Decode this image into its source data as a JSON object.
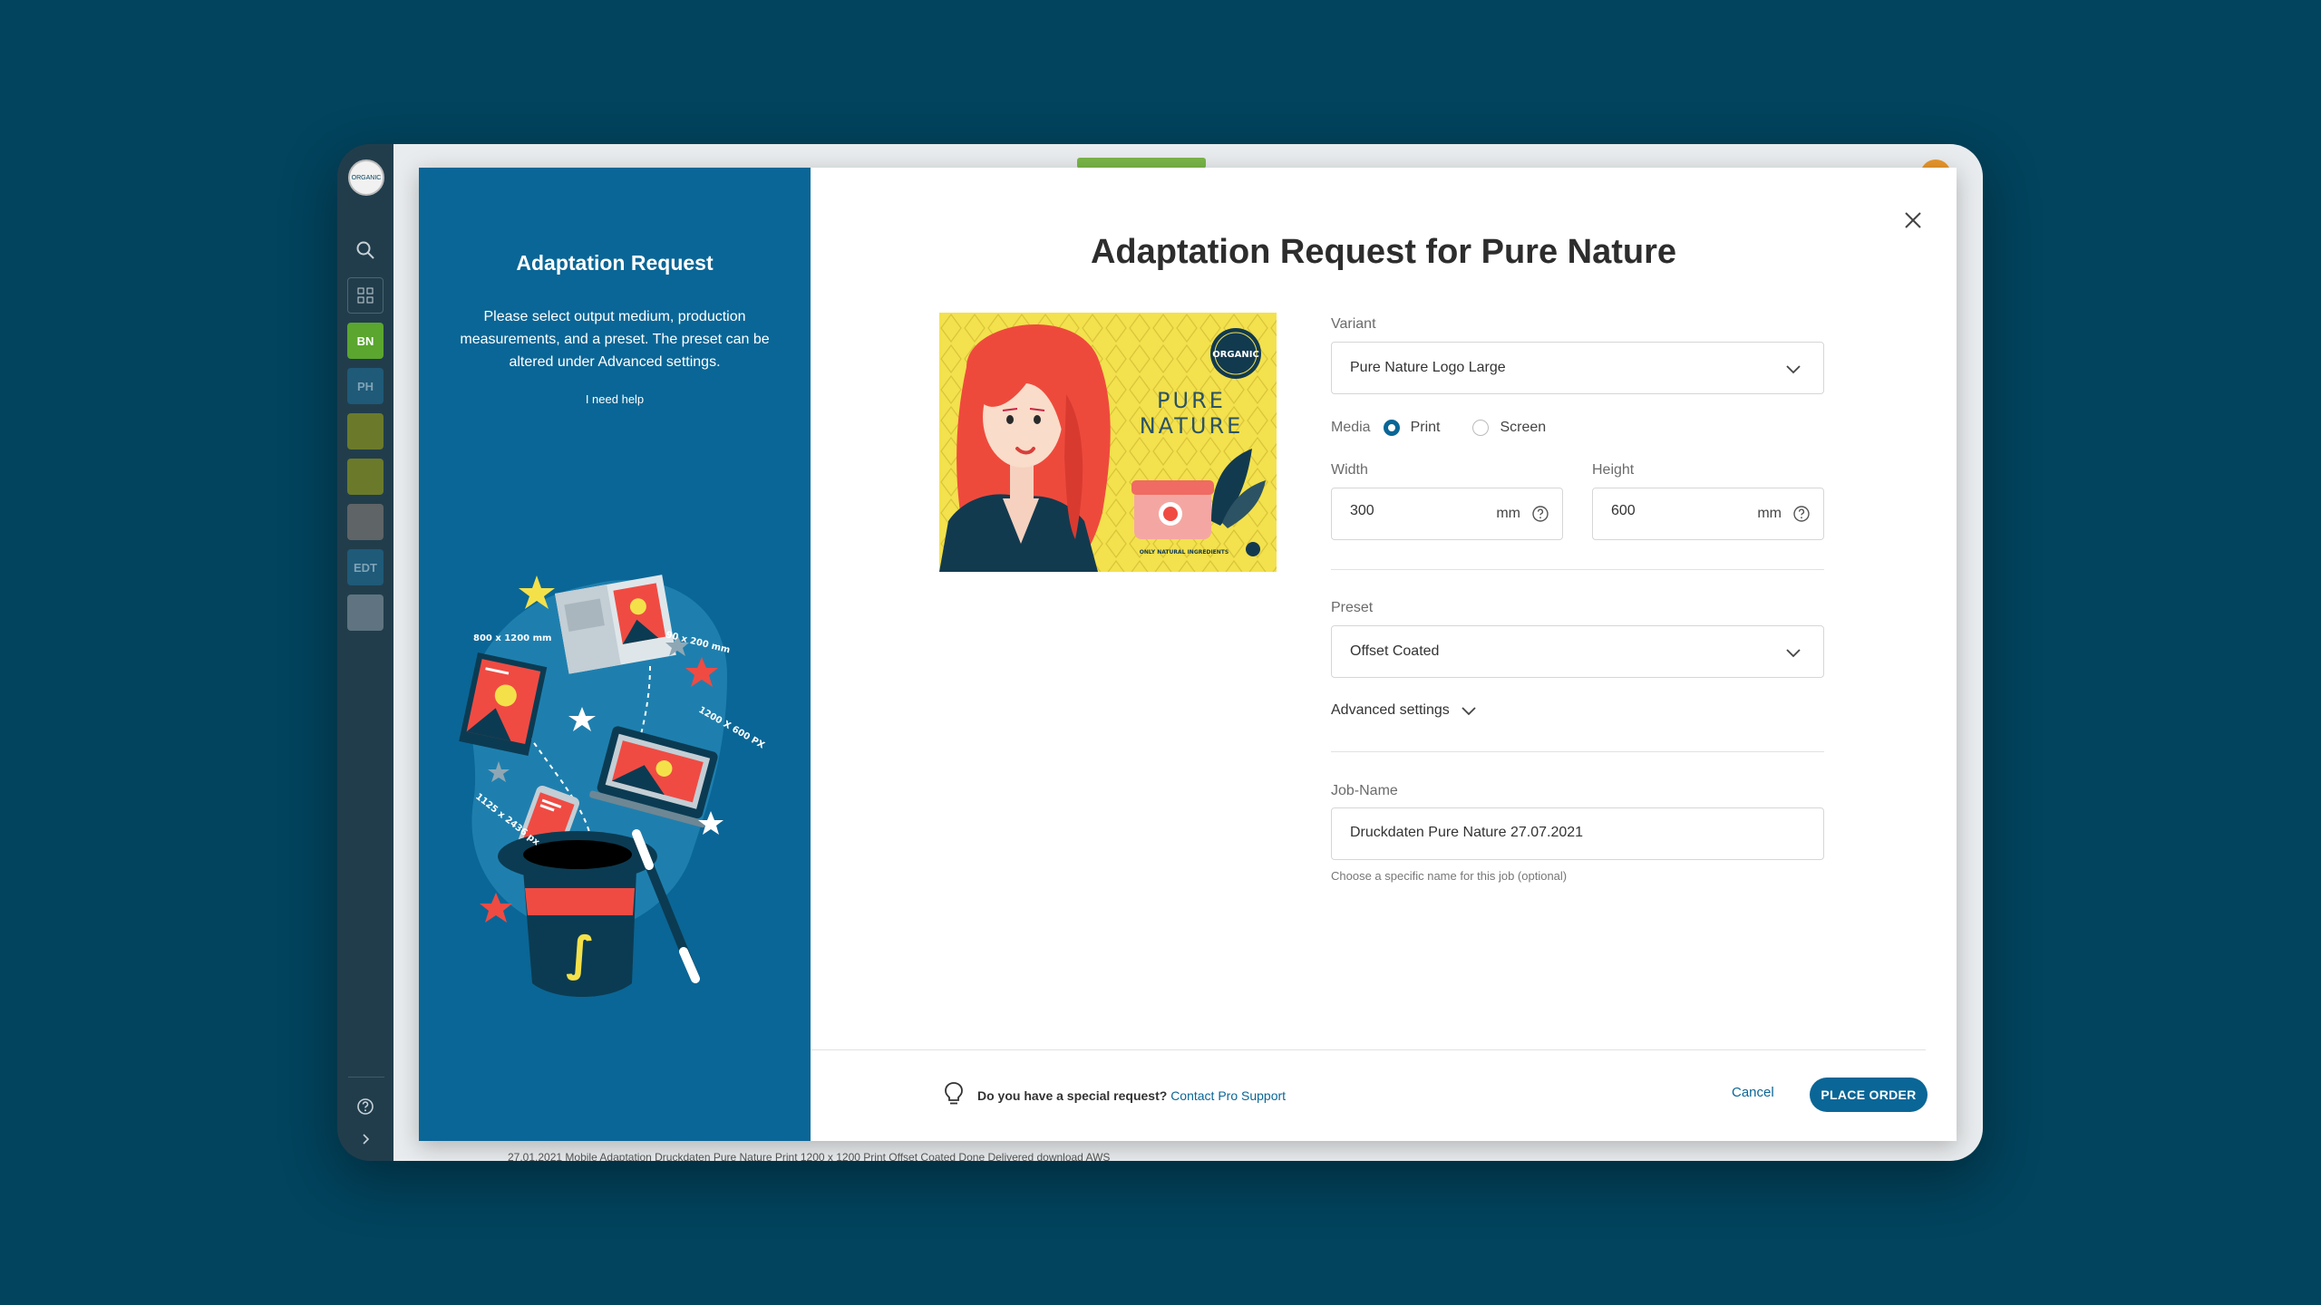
{
  "rail": {
    "logo": "ORGANIC",
    "items": [
      {
        "label": "",
        "icon": "search-icon",
        "color": "#213d4c"
      },
      {
        "label": "",
        "icon": "grid-icon",
        "color": "#213d4c"
      },
      {
        "label": "BN",
        "color": "#5aa62e"
      },
      {
        "label": "PH",
        "color": "#1f5a78"
      },
      {
        "label": "",
        "color": "#6b7a2a"
      },
      {
        "label": "",
        "color": "#6b7a2a"
      },
      {
        "label": "",
        "color": "#5f6466"
      },
      {
        "label": "EDT",
        "color": "#1f5a78"
      },
      {
        "label": "",
        "color": "#5f7480"
      }
    ]
  },
  "app": {
    "footer_text": "27.01.2021    Mobile   Adaptation   Druckdaten Pure Nature   Print   1200 x 1200   Print   Offset Coated   Done   Delivered   download   AWS"
  },
  "left_panel": {
    "title": "Adaptation Request",
    "description": "Please select output medium, production measurements, and a preset. The preset can be altered under Advanced settings.",
    "help_link": "I need help",
    "illustration_labels": [
      "800 x 1200 mm",
      "90 x 200 mm",
      "1200 X 600 PX",
      "1125 x 2436 px"
    ]
  },
  "modal": {
    "title": "Adaptation Request for Pure Nature"
  },
  "preview": {
    "badge": "ORGANIC",
    "brand_line1": "PURE",
    "brand_line2": "NATURE",
    "tagline": "ONLY NATURAL INGREDIENTS"
  },
  "form": {
    "variant": {
      "label": "Variant",
      "value": "Pure Nature Logo Large"
    },
    "media": {
      "label": "Media",
      "options": [
        {
          "label": "Print",
          "selected": true
        },
        {
          "label": "Screen",
          "selected": false
        }
      ]
    },
    "width": {
      "label": "Width",
      "value": "300",
      "unit": "mm"
    },
    "height": {
      "label": "Height",
      "value": "600",
      "unit": "mm"
    },
    "preset": {
      "label": "Preset",
      "value": "Offset Coated"
    },
    "advanced": {
      "label": "Advanced settings"
    },
    "job_name": {
      "label": "Job-Name",
      "value": "Druckdaten Pure Nature 27.07.2021",
      "hint": "Choose a specific name for this job (optional)"
    }
  },
  "footer": {
    "question": "Do you have a special request?",
    "link": "Contact Pro Support",
    "cancel": "Cancel",
    "place_order": "PLACE ORDER"
  },
  "colors": {
    "background": "#02435d",
    "primary": "#0a6696",
    "panel": "#0a6696",
    "accent_red": "#ef4b43",
    "accent_yellow": "#f4e14a"
  }
}
